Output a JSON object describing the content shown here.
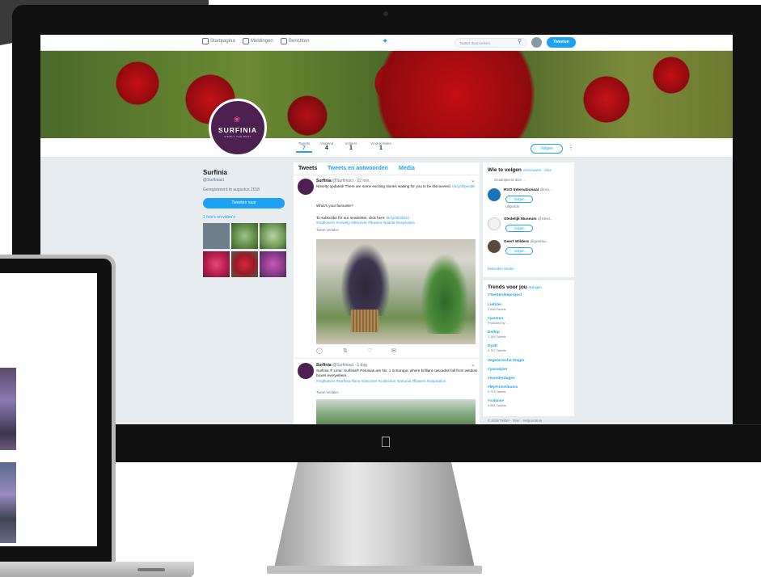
{
  "navbar": {
    "home": "Startpagina",
    "moments": "Meldingen",
    "messages": "Berichten",
    "search_placeholder": "Twitter doorzoeken",
    "tweet_button": "Tweeten"
  },
  "profile": {
    "logo": "SURFINIA",
    "logo_sub": "SIMPLY THE BEST",
    "name": "Surfinia",
    "handle": "@Surfiniact",
    "joined": "Geregistreerd in augustus 2018",
    "tweet_to": "Tweeten naar",
    "photos_link": "1 foto's en video's",
    "follow": "Volgen",
    "stats": [
      {
        "label": "Tweets",
        "value": "7"
      },
      {
        "label": "Volgend",
        "value": "4"
      },
      {
        "label": "Volgers",
        "value": "1"
      },
      {
        "label": "Vind-ik-leuks",
        "value": "1"
      }
    ]
  },
  "timeline": {
    "tabs": [
      "Tweets",
      "Tweets en antwoorden",
      "Media"
    ],
    "tweets": [
      {
        "name": "Surfinia",
        "handle": "@Surfiniact · 22 min.",
        "text1": "Novelty updated! There are some exciting stories waiting for you to be discovered.",
        "link1": "bit.ly/2Ejeo3E",
        "text2": "What's your favourite?",
        "text3": "To subscribe for our newsletter, click here:",
        "link3": "bit.ly/2E3D0iJ",
        "tags": "#mgflowers #novelty #discover #flowers #plants #inspiration",
        "translate": "Tweet vertalen"
      },
      {
        "name": "Surfinia",
        "handle": "@Surfiniact · 1 dag",
        "text1": "Surfinia ® Lime: Surfinia® Petunias are No. 1 in Europe, where brilliant cascades fall from window boxes everywhere...",
        "tags": "#mgflowers #surfinia #lime #discover #collection #petunia #flowers #inspiration",
        "translate": "Tweet vertalen"
      }
    ]
  },
  "who_to_follow": {
    "title": "Wie te volgen",
    "links": "Vernieuwen · Alles",
    "suggestions": [
      {
        "name": "RVO Internationaal",
        "handle": "@rvo...",
        "note": "Geadopteerd door ...",
        "follow": "Volgen",
        "sub": "Uitgelicht"
      },
      {
        "name": "Stedelijk Museum",
        "handle": "@Sted...",
        "follow": "Volgen"
      },
      {
        "name": "Geert Wilders",
        "handle": "@geertw...",
        "follow": "Volgen"
      }
    ],
    "find_people": "Bekenden vinden"
  },
  "trends": {
    "title": "Trends voor jou",
    "change": "Wijzigen",
    "items": [
      {
        "tag": "#Twitterdeeproject",
        "count": ""
      },
      {
        "tag": "Liefster",
        "count": "2.348 Tweets"
      },
      {
        "tag": "#jantzen",
        "count": "Promoted by ..."
      },
      {
        "tag": "Dollop",
        "count": "1.155 Tweets"
      },
      {
        "tag": "Dyatt",
        "count": "3.787 Tweets"
      },
      {
        "tag": "Vegetarische Slager",
        "count": ""
      },
      {
        "tag": "#jaarwijzer",
        "count": ""
      },
      {
        "tag": "#wonderdagen",
        "count": ""
      },
      {
        "tag": "#MyFirstAlbums",
        "count": "9.723 Tweets"
      },
      {
        "tag": "#vallaise",
        "count": "4.981 Tweets"
      }
    ],
    "footer": "© 2018 Twitter · Over · Helpcentrum"
  },
  "colors": {
    "accent": "#1da1f2",
    "brand": "#4c2150",
    "bg": "#e6ecf0"
  }
}
